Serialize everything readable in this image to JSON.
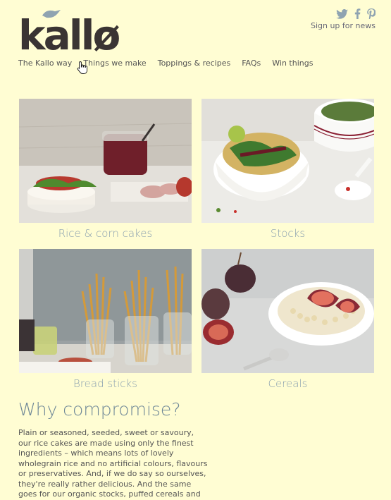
{
  "header": {
    "brand": "kallø",
    "social": {
      "twitter_icon": "twitter-icon",
      "facebook_icon": "facebook-icon",
      "pinterest_icon": "pinterest-icon",
      "signup_label": "Sign up for news"
    },
    "nav": [
      {
        "label": "The Kallo way"
      },
      {
        "label": "Things we make"
      },
      {
        "label": "Toppings & recipes"
      },
      {
        "label": "FAQs"
      },
      {
        "label": "Win things"
      }
    ]
  },
  "products": [
    {
      "label": "Rice & corn cakes"
    },
    {
      "label": "Stocks"
    },
    {
      "label": "Bread sticks"
    },
    {
      "label": "Cereals"
    }
  ],
  "intro": {
    "heading": "Why compromise?",
    "body": "Plain or seasoned, seeded, sweet or savoury, our rice cakes are made using only the finest ingredients – which means lots of lovely wholegrain rice and no artificial colours, flavours or preservatives. And, if we do say so ourselves, they're really rather delicious. And the same goes for our organic stocks, puffed cereals and"
  },
  "colors": {
    "background": "#fffdd3",
    "accent_blue": "#8aa0b0",
    "logo_dark": "#3a3433",
    "bird_blue": "#8fa3b1"
  }
}
